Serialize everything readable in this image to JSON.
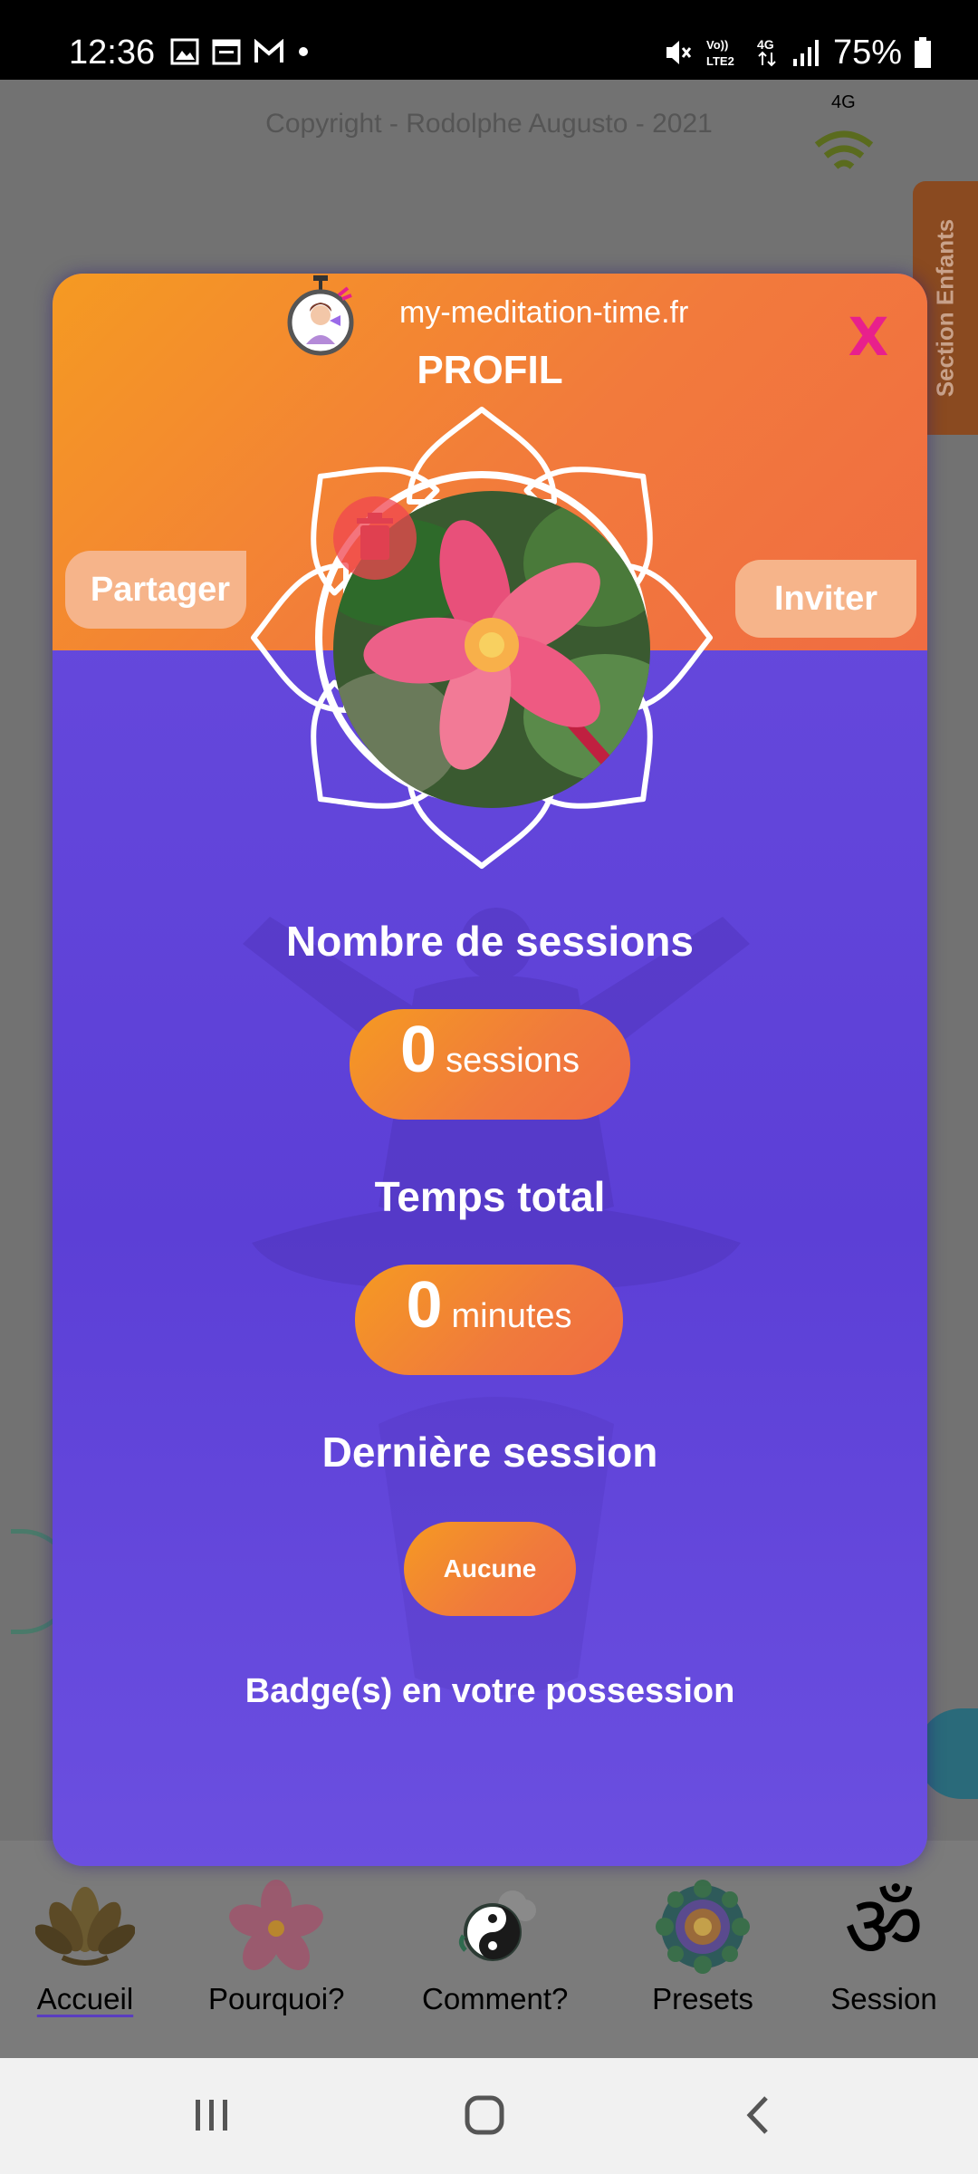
{
  "status_bar": {
    "time": "12:36",
    "battery": "75%",
    "left_icons": [
      "image-icon",
      "calendar-icon",
      "gmail-icon",
      "dot-icon"
    ],
    "right_icons": [
      "mute-icon",
      "volte-icon",
      "4g-icon",
      "signal-icon",
      "battery-icon"
    ]
  },
  "background": {
    "copyright": "Copyright - Rodolphe Augusto - 2021",
    "network_label": "4G",
    "side_tab_label": "Section Enfants"
  },
  "modal": {
    "site_name": "my-meditation-time.fr",
    "title": "PROFIL",
    "close_label": "X",
    "share_button": "Partager",
    "invite_button": "Inviter",
    "sessions_heading": "Nombre de sessions",
    "sessions_value": "0",
    "sessions_unit": "sessions",
    "total_time_heading": "Temps total",
    "total_time_value": "0",
    "total_time_unit": "minutes",
    "last_session_heading": "Dernière session",
    "last_session_value": "Aucune",
    "badges_heading": "Badge(s) en votre possession"
  },
  "bottom_nav": {
    "items": [
      {
        "label": "Accueil",
        "icon": "lotus-icon",
        "active": true
      },
      {
        "label": "Pourquoi?",
        "icon": "flower-icon",
        "active": false
      },
      {
        "label": "Comment?",
        "icon": "yin-yang-icon",
        "active": false
      },
      {
        "label": "Presets",
        "icon": "mandala-icon",
        "active": false
      },
      {
        "label": "Session",
        "icon": "om-icon",
        "active": false
      }
    ]
  },
  "colors": {
    "modal_purple": "#6a4ddf",
    "header_orange": "#f59a22",
    "close_pink": "#e8208c"
  }
}
